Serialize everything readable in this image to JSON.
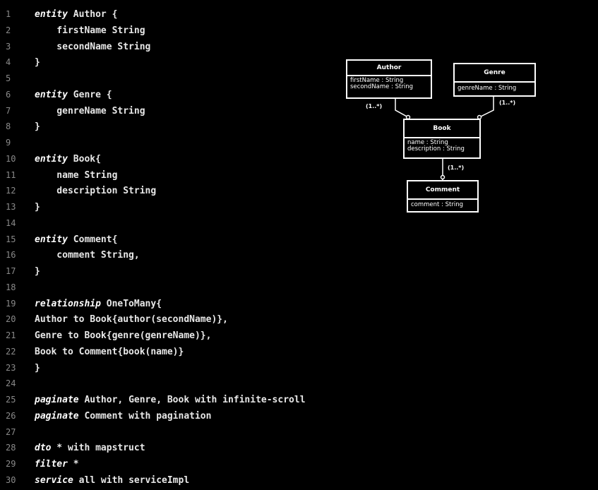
{
  "lines": [
    {
      "n": "1",
      "kw": "entity",
      "text": " Author {"
    },
    {
      "n": "2",
      "kw": "",
      "text": "    firstName String"
    },
    {
      "n": "3",
      "kw": "",
      "text": "    secondName String"
    },
    {
      "n": "4",
      "kw": "",
      "text": "}"
    },
    {
      "n": "5",
      "kw": "",
      "text": ""
    },
    {
      "n": "6",
      "kw": "entity",
      "text": " Genre {"
    },
    {
      "n": "7",
      "kw": "",
      "text": "    genreName String"
    },
    {
      "n": "8",
      "kw": "",
      "text": "}"
    },
    {
      "n": "9",
      "kw": "",
      "text": ""
    },
    {
      "n": "10",
      "kw": "entity",
      "text": " Book{"
    },
    {
      "n": "11",
      "kw": "",
      "text": "    name String"
    },
    {
      "n": "12",
      "kw": "",
      "text": "    description String"
    },
    {
      "n": "13",
      "kw": "",
      "text": "}"
    },
    {
      "n": "14",
      "kw": "",
      "text": ""
    },
    {
      "n": "15",
      "kw": "entity",
      "text": " Comment{"
    },
    {
      "n": "16",
      "kw": "",
      "text": "    comment String,"
    },
    {
      "n": "17",
      "kw": "",
      "text": "}"
    },
    {
      "n": "18",
      "kw": "",
      "text": ""
    },
    {
      "n": "19",
      "kw": "relationship",
      "text": " OneToMany{"
    },
    {
      "n": "20",
      "kw": "",
      "text": "Author to Book{author(secondName)},"
    },
    {
      "n": "21",
      "kw": "",
      "text": "Genre to Book{genre(genreName)},"
    },
    {
      "n": "22",
      "kw": "",
      "text": "Book to Comment{book(name)}"
    },
    {
      "n": "23",
      "kw": "",
      "text": "}"
    },
    {
      "n": "24",
      "kw": "",
      "text": ""
    },
    {
      "n": "25",
      "kw": "paginate",
      "text": " Author, Genre, Book with infinite-scroll"
    },
    {
      "n": "26",
      "kw": "paginate",
      "text": " Comment with pagination"
    },
    {
      "n": "27",
      "kw": "",
      "text": ""
    },
    {
      "n": "28",
      "kw": "dto",
      "text": " * with mapstruct"
    },
    {
      "n": "29",
      "kw": "filter",
      "text": " *"
    },
    {
      "n": "30",
      "kw": "service",
      "text": " all with serviceImpl"
    }
  ],
  "diagram": {
    "author": {
      "title": "Author",
      "attrs": [
        "firstName : String",
        "secondName : String"
      ]
    },
    "genre": {
      "title": "Genre",
      "attrs": [
        "genreName : String"
      ]
    },
    "book": {
      "title": "Book",
      "attrs": [
        "name : String",
        "description : String"
      ]
    },
    "comment": {
      "title": "Comment",
      "attrs": [
        "comment : String"
      ]
    },
    "mult_author": "(1..*)",
    "mult_genre": "(1..*)",
    "mult_book": "(1..*)"
  },
  "colors": {
    "background": "#000000",
    "text": "#ffffff",
    "line_numbers": "#8a8a8a"
  }
}
